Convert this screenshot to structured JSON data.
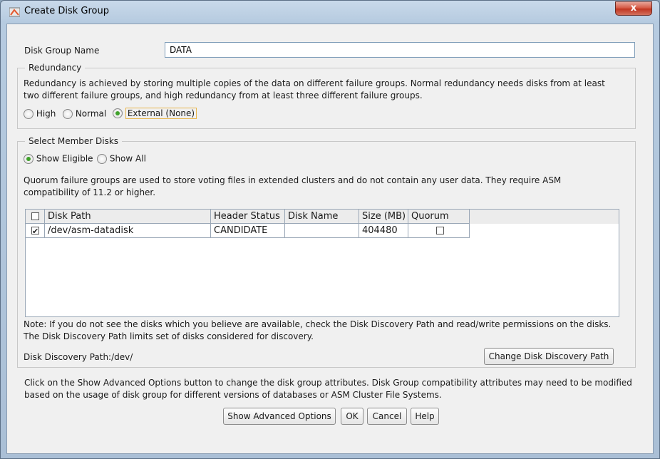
{
  "window": {
    "title": "Create Disk Group",
    "close_label": "x"
  },
  "disk_group_name": {
    "label": "Disk Group Name",
    "value": "DATA"
  },
  "redundancy": {
    "legend": "Redundancy",
    "description_line1": "Redundancy is achieved by storing multiple copies of the data on different failure groups. Normal redundancy needs disks from at least",
    "description_line2": "two different failure groups, and high redundancy from at least three different failure groups.",
    "options": [
      "High",
      "Normal",
      "External (None)"
    ],
    "selected": "External (None)"
  },
  "member_disks": {
    "legend": "Select Member Disks",
    "show_options": [
      "Show Eligible",
      "Show All"
    ],
    "selected_show": "Show Eligible",
    "quorum_note_line1": "Quorum failure groups are used to store voting files in extended clusters and do not contain any user data. They require ASM",
    "quorum_note_line2": "compatibility of 11.2 or higher.",
    "table": {
      "columns": [
        "Disk Path",
        "Header Status",
        "Disk Name",
        "Size (MB)",
        "Quorum"
      ],
      "rows": [
        {
          "selected": true,
          "disk_path": "/dev/asm-datadisk",
          "header_status": "CANDIDATE",
          "disk_name": "",
          "size_mb": "404480",
          "quorum": false
        }
      ]
    },
    "note_line1": "Note: If you do not see the disks which you believe are available, check the Disk Discovery Path and read/write permissions on the disks.",
    "note_line2": "The Disk Discovery Path limits set of disks considered for discovery.",
    "discovery_path_label": "Disk Discovery Path:/dev/",
    "change_path_button": "Change Disk Discovery Path"
  },
  "advanced_info_line1": "Click on the Show Advanced Options button to change the disk group attributes. Disk Group compatibility attributes may need to be modified",
  "advanced_info_line2": "based on the usage of disk group for different versions of databases or ASM Cluster File Systems.",
  "buttons": {
    "advanced": "Show Advanced Options",
    "ok": "OK",
    "cancel": "Cancel",
    "help": "Help"
  }
}
